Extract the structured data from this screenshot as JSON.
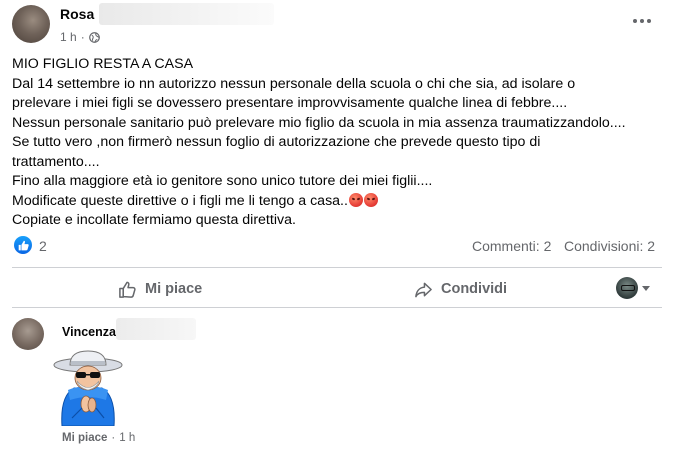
{
  "post": {
    "author_name": "Rosa",
    "timestamp": "1 h",
    "separator": "·",
    "audience_icon": "globe-icon",
    "text_lines": [
      "MIO FIGLIO RESTA A CASA",
      "Dal 14 settembre io nn autorizzo nessun personale della scuola o chi che sia, ad isolare o",
      "prelevare i miei figli se dovessero presentare improvvisamente qualche linea di febbre....",
      "Nessun personale sanitario può prelevare mio figlio da scuola in mia assenza  traumatizzandolo....",
      "Se tutto vero ,non firmerò nessun foglio di autorizzazione che prevede questo tipo di",
      "trattamento....",
      "Fino alla maggiore età io genitore sono unico tutore dei miei figlii....",
      "Modificate queste direttive o i figli me li tengo a casa..",
      "Copiate e incollate fermiamo questa direttiva."
    ],
    "reactions": {
      "icon": "thumbs-up-icon",
      "count": "2"
    },
    "comments_label": "Commenti: 2",
    "shares_label": "Condivisioni: 2"
  },
  "actions": {
    "like_label": "Mi piace",
    "share_label": "Condividi"
  },
  "comment": {
    "author_name": "Vincenza",
    "sticker": "sticker-old-man-in-blue-hoodie",
    "like_label": "Mi piace",
    "separator": "·",
    "timestamp": "1 h"
  },
  "colors": {
    "accent": "#1877f2",
    "secondary_text": "#65676b",
    "divider": "#ced0d4"
  }
}
